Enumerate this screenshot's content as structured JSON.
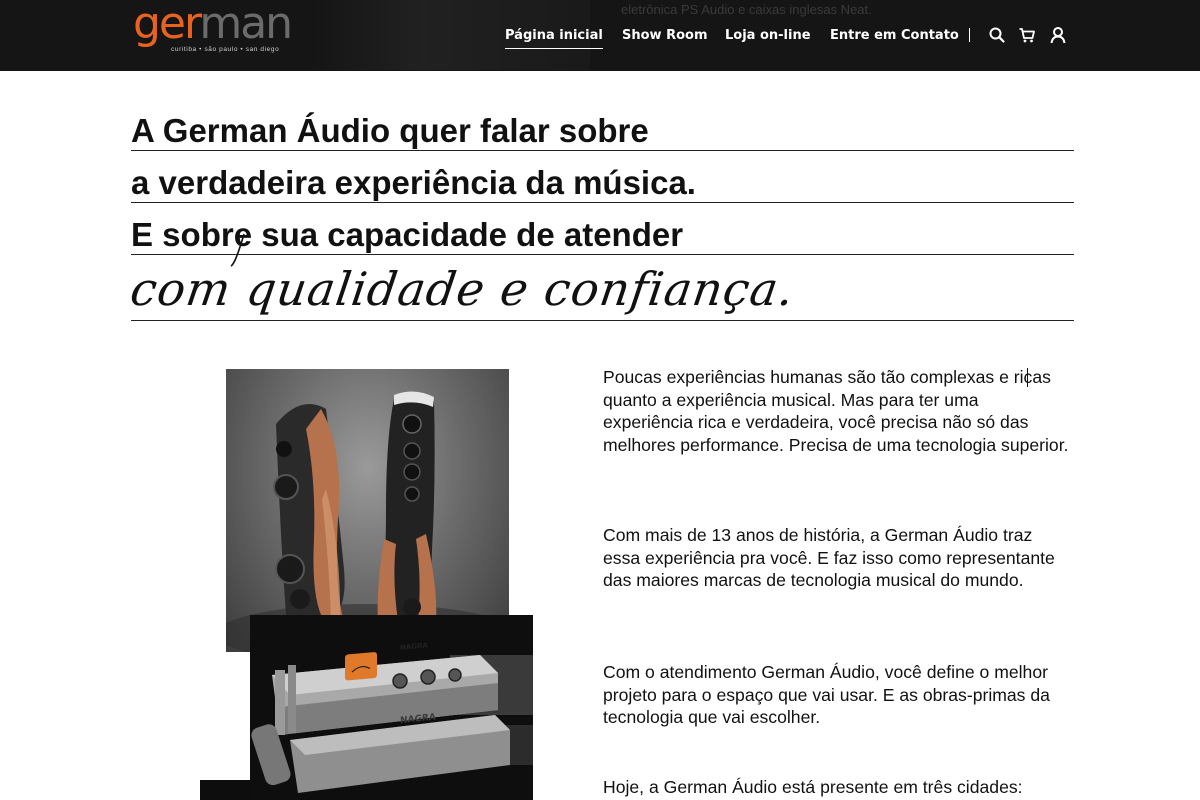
{
  "header": {
    "logo_text": "german",
    "logo_tagline": "curitiba • são paulo • san diego",
    "background_ghost_text": "eletrônica PS Audio e caixas inglesas Neat.",
    "nav": [
      {
        "label": "Página inicial",
        "active": true
      },
      {
        "label": "Show Room",
        "active": false
      },
      {
        "label": "Loja on-line",
        "active": false
      },
      {
        "label": "Entre em Contato",
        "active": false
      }
    ],
    "icons": [
      "search-icon",
      "cart-icon",
      "user-icon"
    ]
  },
  "headline": {
    "lines": [
      "A German Áudio quer falar sobre",
      "a verdadeira experiência da música.",
      "E sobre sua capacidade de atender"
    ],
    "script": "com qualidade e confiança."
  },
  "content": {
    "paragraphs": [
      "Poucas experiências humanas são tão complexas e ricas quanto a experiência musical. Mas para ter uma experiência rica e verdadeira, você precisa não só das melhores performance. Precisa de uma tecnologia superior.",
      "Com mais de 13 anos de história, a German Áudio traz essa experiência pra você. E faz isso como representante das maiores marcas de tecnologia musical do mundo.",
      "Com o atendimento German Áudio, você define o melhor projeto para o espaço que vai usar. E as obras-primas da tecnologia que vai escolher.",
      "Hoje, a German Áudio está presente em três cidades:"
    ],
    "images": {
      "amp_brand": "NAGRA"
    }
  },
  "colors": {
    "header_bg": "#151515",
    "brand_orange": "#e8631f",
    "text": "#111111"
  }
}
